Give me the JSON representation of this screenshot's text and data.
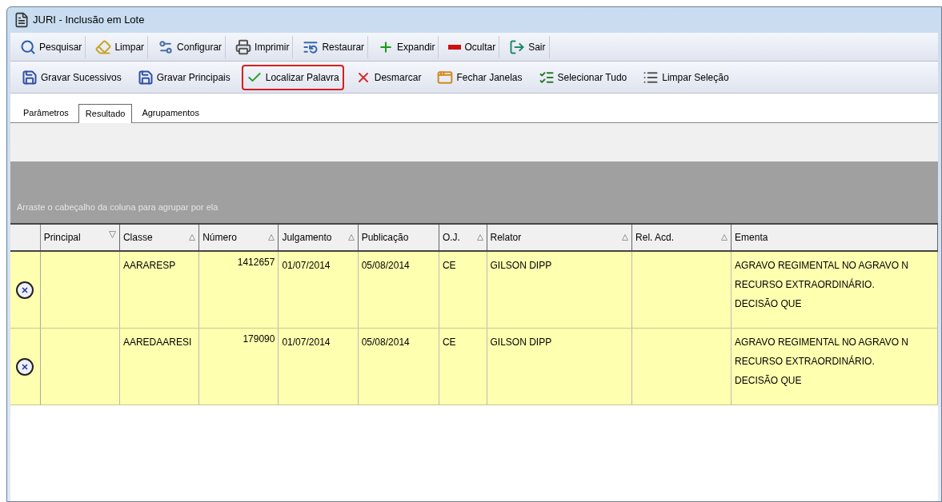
{
  "window": {
    "title": "JURI - Inclusão em Lote"
  },
  "toolbar_1": [
    {
      "label": "Pesquisar"
    },
    {
      "label": "Limpar"
    },
    {
      "label": "Configurar"
    },
    {
      "label": "Imprimir"
    },
    {
      "label": "Restaurar"
    },
    {
      "label": "Expandir"
    },
    {
      "label": "Ocultar"
    },
    {
      "label": "Sair"
    }
  ],
  "toolbar_2": [
    {
      "label": "Gravar Sucessivos",
      "highlighted": false
    },
    {
      "label": "Gravar Principais",
      "highlighted": false
    },
    {
      "label": "Localizar Palavra",
      "highlighted": true
    },
    {
      "label": "Desmarcar",
      "highlighted": false
    },
    {
      "label": "Fechar Janelas",
      "highlighted": false
    },
    {
      "label": "Selecionar Tudo",
      "highlighted": false
    },
    {
      "label": "Limpar Seleção",
      "highlighted": false
    }
  ],
  "tabs": [
    {
      "label": "Parâmetros",
      "selected": false
    },
    {
      "label": "Resultado",
      "selected": true
    },
    {
      "label": "Agrupamentos",
      "selected": false
    }
  ],
  "group_panel": {
    "hint": "Arraste o cabeçalho da coluna para agrupar por ela"
  },
  "table": {
    "columns": [
      {
        "label": "Principal",
        "sorted": true,
        "descending": true
      },
      {
        "label": "Classe",
        "sorted": true,
        "descending": false
      },
      {
        "label": "Número",
        "sorted": true,
        "descending": false
      },
      {
        "label": "Julgamento",
        "sorted": true,
        "descending": false
      },
      {
        "label": "Publicação",
        "sorted": false
      },
      {
        "label": "O.J.",
        "sorted": true,
        "descending": false
      },
      {
        "label": "Relator",
        "sorted": true,
        "descending": false
      },
      {
        "label": "Rel. Acd.",
        "sorted": true,
        "descending": false
      },
      {
        "label": "Ementa",
        "sorted": false
      }
    ],
    "rows": [
      {
        "cells": [
          "",
          "AARARESP",
          "1412657",
          "01/07/2014",
          "05/08/2014",
          "CE",
          "GILSON DIPP",
          "",
          "AGRAVO REGIMENTAL NO AGRAVO N\nRECURSO EXTRAORDINÁRIO.\nDECISÃO QUE"
        ]
      },
      {
        "cells": [
          "",
          "AAREDAARESI",
          "179090",
          "01/07/2014",
          "05/08/2014",
          "CE",
          "GILSON DIPP",
          "",
          "AGRAVO REGIMENTAL NO AGRAVO N\nRECURSO EXTRAORDINÁRIO.\nDECISÃO QUE"
        ]
      }
    ]
  }
}
